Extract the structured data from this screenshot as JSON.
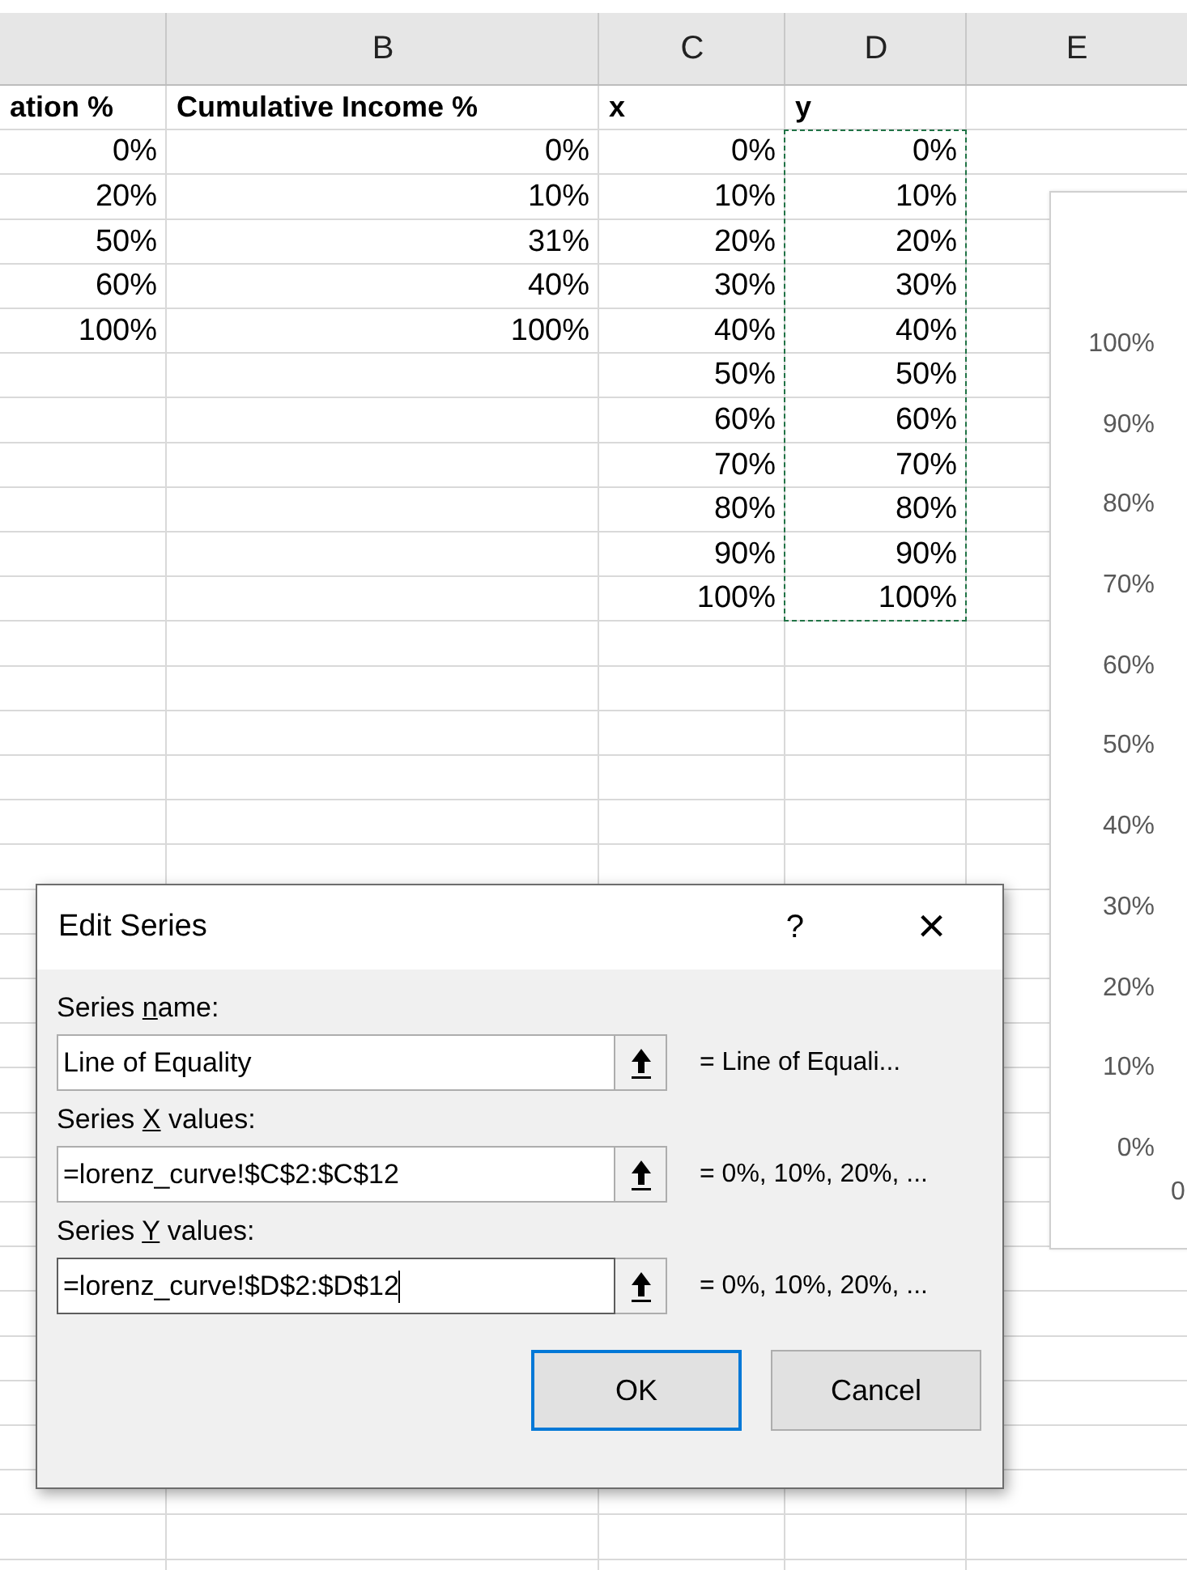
{
  "sheet": {
    "columns": [
      {
        "marquee": false
      },
      {
        "letter": "B",
        "marquee": false
      },
      {
        "letter": "C",
        "marquee": false
      },
      {
        "letter": "D",
        "marquee": true
      },
      {
        "letter": "E",
        "marquee": false
      }
    ],
    "header_cells": [
      "ation %",
      "Cumulative Income %",
      "x",
      "y",
      ""
    ],
    "rows": [
      [
        "0%",
        "0%",
        "0%",
        "0%",
        ""
      ],
      [
        "20%",
        "10%",
        "10%",
        "10%",
        ""
      ],
      [
        "50%",
        "31%",
        "20%",
        "20%",
        ""
      ],
      [
        "60%",
        "40%",
        "30%",
        "30%",
        ""
      ],
      [
        "100%",
        "100%",
        "40%",
        "40%",
        ""
      ],
      [
        "",
        "",
        "50%",
        "50%",
        ""
      ],
      [
        "",
        "",
        "60%",
        "60%",
        ""
      ],
      [
        "",
        "",
        "70%",
        "70%",
        ""
      ],
      [
        "",
        "",
        "80%",
        "80%",
        ""
      ],
      [
        "",
        "",
        "90%",
        "90%",
        ""
      ],
      [
        "",
        "",
        "100%",
        "100%",
        ""
      ]
    ]
  },
  "chart": {
    "y_axis_labels": [
      "100%",
      "90%",
      "80%",
      "70%",
      "60%",
      "50%",
      "40%",
      "30%",
      "20%",
      "10%",
      "0%"
    ],
    "x_axis_labels": [
      "0"
    ]
  },
  "dialog": {
    "title": "Edit Series",
    "help": "?",
    "close": "×",
    "fields": [
      {
        "label_before": "Series ",
        "label_key": "n",
        "label_after": "ame:",
        "value": "Line of Equality",
        "focused": false,
        "preview": "= Line of Equali..."
      },
      {
        "label_before": "Series ",
        "label_key": "X",
        "label_after": " values:",
        "value": "=lorenz_curve!$C$2:$C$12",
        "focused": false,
        "preview": "= 0%, 10%, 20%, ..."
      },
      {
        "label_before": "Series ",
        "label_key": "Y",
        "label_after": " values:",
        "value": "=lorenz_curve!$D$2:$D$12",
        "focused": true,
        "preview": "= 0%, 10%, 20%, ..."
      }
    ],
    "buttons": [
      {
        "label": "OK",
        "default": true
      },
      {
        "label": "Cancel",
        "default": false
      }
    ]
  }
}
